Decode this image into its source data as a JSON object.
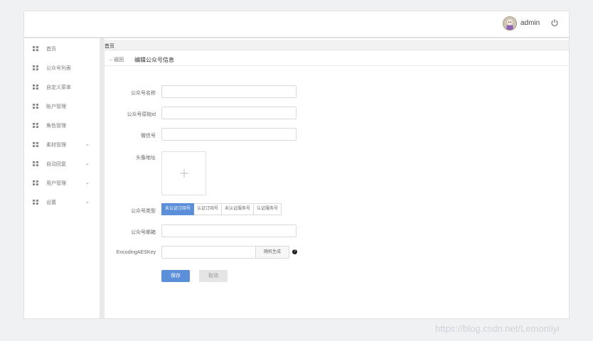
{
  "header": {
    "username": "admin",
    "avatar_icon": "user-avatar",
    "power_icon": "power-icon"
  },
  "sidebar": {
    "items": [
      {
        "label": "首页",
        "has_submenu": false
      },
      {
        "label": "公众号列表",
        "has_submenu": false
      },
      {
        "label": "自定义菜单",
        "has_submenu": false
      },
      {
        "label": "账户管理",
        "has_submenu": false
      },
      {
        "label": "角色管理",
        "has_submenu": false
      },
      {
        "label": "素材管理",
        "has_submenu": true
      },
      {
        "label": "自动回复",
        "has_submenu": true
      },
      {
        "label": "用户管理",
        "has_submenu": true
      },
      {
        "label": "设置",
        "has_submenu": true
      }
    ],
    "chevron": "⌄"
  },
  "breadcrumb": {
    "current": "首页"
  },
  "page": {
    "back_label": "←返回",
    "title": "编辑公众号信息"
  },
  "form": {
    "name_label": "公众号名称",
    "name_value": "",
    "origin_id_label": "公众号原始id",
    "origin_id_value": "",
    "wechat_label": "微信号",
    "wechat_value": "",
    "avatar_label": "头像地址",
    "type_label": "公众号类型",
    "type_options": [
      "未认证订阅号",
      "认证订阅号",
      "未认证服务号",
      "认证服务号"
    ],
    "type_selected": "未认证订阅号",
    "email_label": "公众号邮箱",
    "email_value": "",
    "aes_label": "EncodingAESKey",
    "aes_value": "",
    "aes_generate_label": "随机生成",
    "help_symbol": "?",
    "save_label": "保存",
    "cancel_label": "取消"
  },
  "watermark": "https://blog.csdn.net/Lemonliyi",
  "colors": {
    "primary": "#5b8fd9",
    "cancel_bg": "#e5e5e5"
  }
}
